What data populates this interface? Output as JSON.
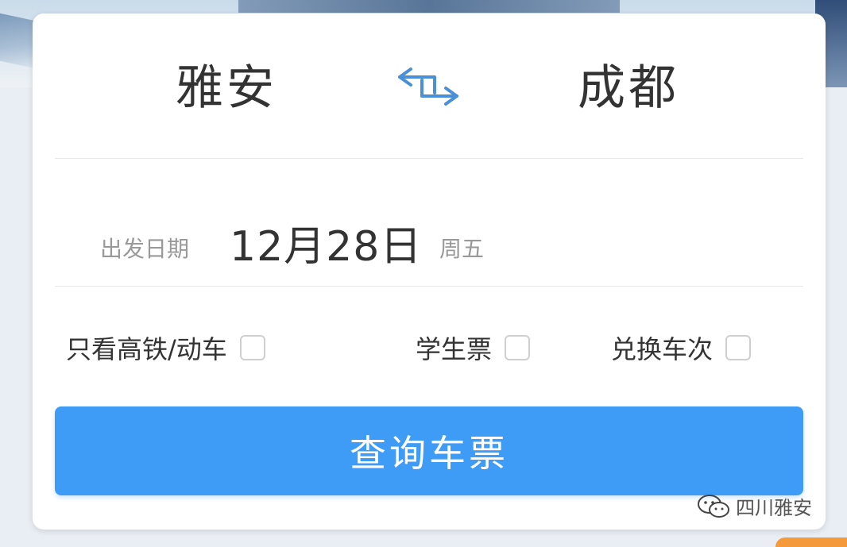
{
  "route": {
    "from_city": "雅安",
    "to_city": "成都",
    "swap_icon": "swap-arrows-icon"
  },
  "date": {
    "label": "出发日期",
    "value": "12月28日",
    "weekday": "周五"
  },
  "options": [
    {
      "label": "只看高铁/动车",
      "checked": false
    },
    {
      "label": "学生票",
      "checked": false
    },
    {
      "label": "兑换车次",
      "checked": false
    }
  ],
  "search_button": {
    "label": "查询车票"
  },
  "watermark": {
    "text": "四川雅安",
    "icon": "wechat-icon"
  },
  "colors": {
    "accent": "#3f9cf6",
    "text": "#333333",
    "muted": "#999999"
  }
}
